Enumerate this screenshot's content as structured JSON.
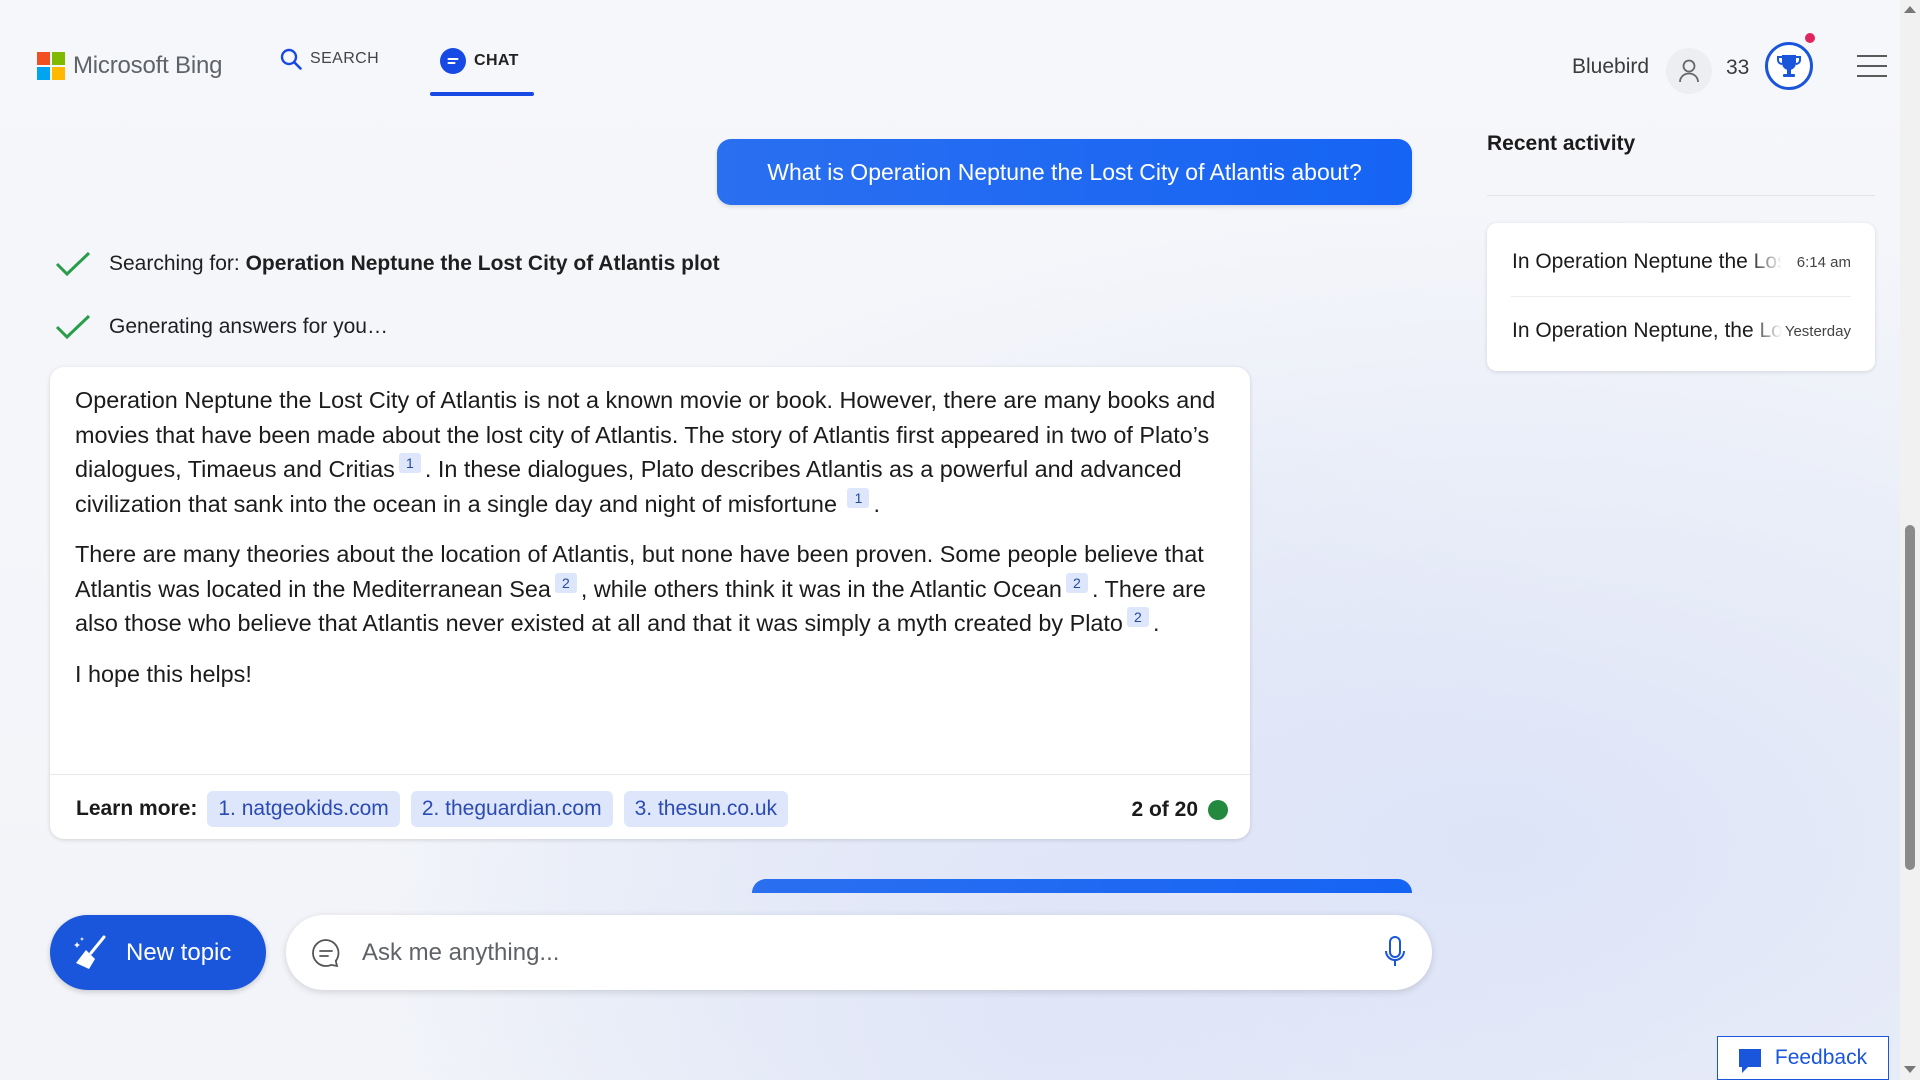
{
  "header": {
    "brand": "Microsoft Bing",
    "tabs": [
      {
        "label": "SEARCH",
        "icon": "search-icon"
      },
      {
        "label": "CHAT",
        "icon": "chat-bubble-icon",
        "active": true
      }
    ],
    "user_name": "Bluebird",
    "points": "33"
  },
  "conversation": {
    "user_message": "What is Operation Neptune the Lost City of Atlantis about?",
    "status": [
      {
        "prefix": "Searching for: ",
        "query": "Operation Neptune the Lost City of Atlantis plot"
      },
      {
        "text": "Generating answers for you…"
      }
    ],
    "answer": {
      "p1": [
        "Operation Neptune the Lost City of Atlantis is not a known movie or book. However, there are many books and movies that have been made about the lost city of Atlantis. The story of Atlantis first appeared in two of Plato’s dialogues, Timaeus and Critias",
        "1",
        ". In these dialogues, Plato describes Atlantis as a powerful and advanced civilization that sank into the ocean in a single day and night of misfortune",
        "1",
        "."
      ],
      "p2": [
        "There are many theories about the location of Atlantis, but none have been proven. Some people believe that Atlantis was located in the Mediterranean Sea",
        "2",
        ", while others think it was in the Atlantic Ocean",
        "2",
        ". There are also those who believe that Atlantis never existed at all and that it was simply a myth created by Plato",
        "2",
        "."
      ],
      "p3": "I hope this helps!",
      "learn_more_label": "Learn more:",
      "sources": [
        "1. natgeokids.com",
        "2. theguardian.com",
        "3. thesun.co.uk"
      ],
      "page_count": "2 of 20",
      "status_color": "#22893f"
    }
  },
  "composer": {
    "new_topic_label": "New topic",
    "placeholder": "Ask me anything..."
  },
  "recent_activity": {
    "title": "Recent activity",
    "items": [
      {
        "text": "In Operation Neptune the Lost City of Atlantis",
        "time": "6:14 am"
      },
      {
        "text": "In Operation Neptune, the Lost City of Atlantis",
        "time": "Yesterday"
      }
    ]
  },
  "feedback_label": "Feedback",
  "colors": {
    "accent": "#1a56db",
    "user_bubble": "#1664f4"
  }
}
